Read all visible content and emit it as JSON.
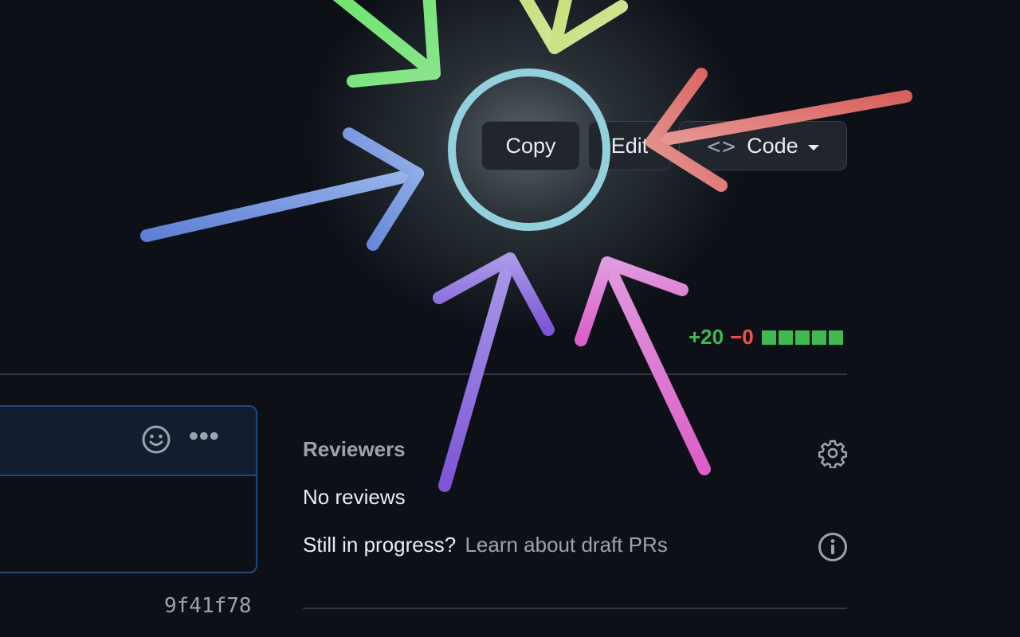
{
  "actions": {
    "copy_label": "Copy",
    "edit_label": "Edit",
    "code_label": "Code",
    "code_icon": "code-brackets-icon",
    "code_brackets": "<>"
  },
  "diffstat": {
    "additions": "+20",
    "deletions": "−0",
    "blocks": 5,
    "color_add": "#3fb950",
    "color_del": "#f85149"
  },
  "comment": {
    "sha": "9f41f78",
    "reaction_icon": "smiley-icon",
    "menu_icon": "kebab-menu-icon"
  },
  "sidebar": {
    "reviewers_title": "Reviewers",
    "reviewers_icon": "gear-icon",
    "no_reviews": "No reviews",
    "progress_question": "Still in progress?",
    "progress_link": "Learn about draft PRs",
    "progress_icon": "info-icon"
  },
  "annotation": {
    "ring_color": "#93cfdc"
  }
}
